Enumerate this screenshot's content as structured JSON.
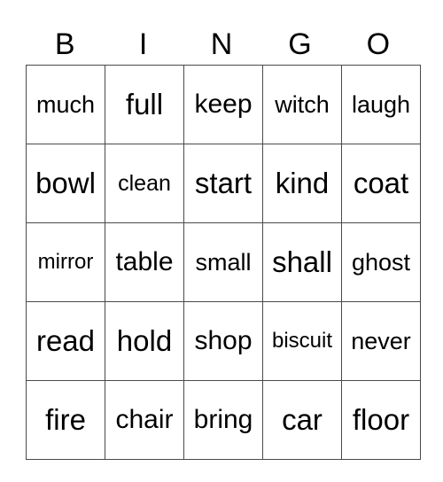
{
  "header": [
    "B",
    "I",
    "N",
    "G",
    "O"
  ],
  "rows": [
    [
      "much",
      "full",
      "keep",
      "witch",
      "laugh"
    ],
    [
      "bowl",
      "clean",
      "start",
      "kind",
      "coat"
    ],
    [
      "mirror",
      "table",
      "small",
      "shall",
      "ghost"
    ],
    [
      "read",
      "hold",
      "shop",
      "biscuit",
      "never"
    ],
    [
      "fire",
      "chair",
      "bring",
      "car",
      "floor"
    ]
  ]
}
